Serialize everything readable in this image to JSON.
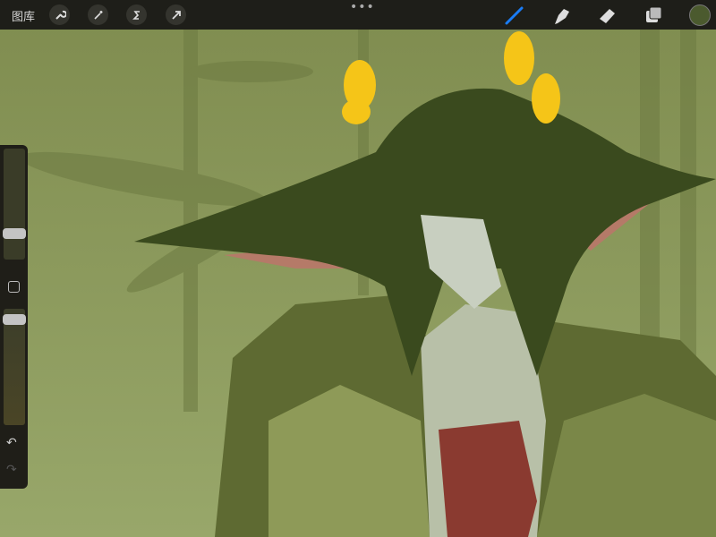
{
  "topbar": {
    "gallery_label": "图库",
    "left_tools": [
      "wrench-icon",
      "magic-wand-icon",
      "selection-icon",
      "transform-arrow-icon"
    ],
    "more_label": "•••",
    "right_tools": [
      "brush-icon",
      "smudge-icon",
      "eraser-icon",
      "layers-icon"
    ],
    "active_tool": "brush"
  },
  "colors": {
    "current_color": "#4b5a2e",
    "accent": "#1a7cf5"
  },
  "sidebar": {
    "brush_size_fraction": 0.23,
    "opacity_fraction": 0.9,
    "modify_label": "modify-button",
    "undo_icon": "undo-icon",
    "redo_icon": "redo-icon"
  }
}
